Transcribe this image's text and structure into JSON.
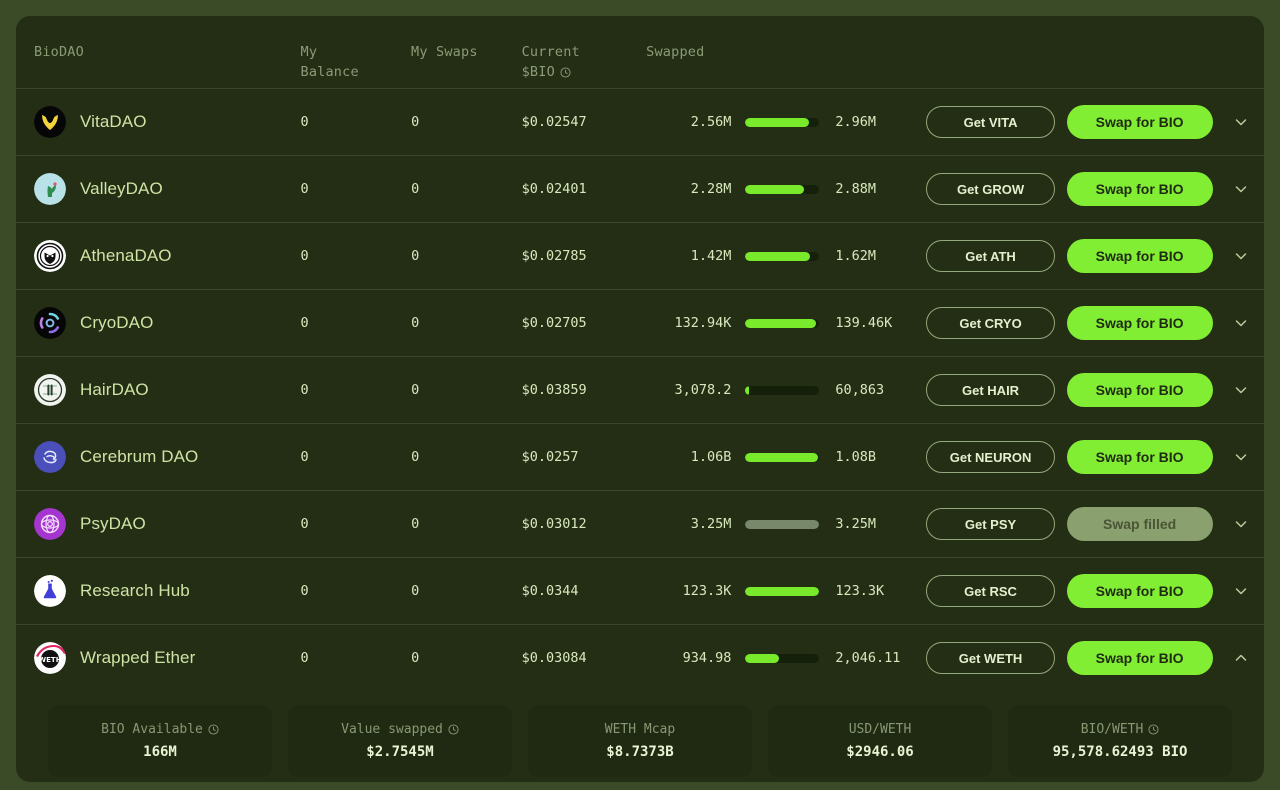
{
  "theme": {
    "page_bg": "#3b4a27",
    "card_bg": "#242e15",
    "accent_green": "#82ee33",
    "bar_fill": "#79e92c",
    "bar_track": "#14200a",
    "muted_fill": "#78886a",
    "text": "#d8e8bd",
    "muted_text": "#8b9b76"
  },
  "table": {
    "columns": [
      {
        "key": "biodao",
        "label": "BioDAO"
      },
      {
        "key": "balance",
        "label": "My\nBalance"
      },
      {
        "key": "swaps",
        "label": "My Swaps"
      },
      {
        "key": "price",
        "label": "Current\n$BIO",
        "info_icon": "clock-info-icon"
      },
      {
        "key": "swapped",
        "label": "Swapped"
      }
    ],
    "header": {
      "biodao": "BioDAO",
      "balance_line1": "My",
      "balance_line2": "Balance",
      "swaps": "My Swaps",
      "price_line1": "Current",
      "price_line2": "$BIO",
      "swapped": "Swapped"
    },
    "rows": [
      {
        "name": "VitaDAO",
        "icon": "vitadao-logo",
        "balance": "0",
        "swaps": "0",
        "price": "$0.02547",
        "swapped_current": "2.56M",
        "swapped_target": "2.96M",
        "progress_pct": 86,
        "get_label": "Get VITA",
        "swap_label": "Swap for BIO",
        "swap_disabled": false,
        "chevron": "chevron-down-icon"
      },
      {
        "name": "ValleyDAO",
        "icon": "valleydao-logo",
        "balance": "0",
        "swaps": "0",
        "price": "$0.02401",
        "swapped_current": "2.28M",
        "swapped_target": "2.88M",
        "progress_pct": 79,
        "get_label": "Get GROW",
        "swap_label": "Swap for BIO",
        "swap_disabled": false,
        "chevron": "chevron-down-icon"
      },
      {
        "name": "AthenaDAO",
        "icon": "athenadao-logo",
        "balance": "0",
        "swaps": "0",
        "price": "$0.02785",
        "swapped_current": "1.42M",
        "swapped_target": "1.62M",
        "progress_pct": 88,
        "get_label": "Get ATH",
        "swap_label": "Swap for BIO",
        "swap_disabled": false,
        "chevron": "chevron-down-icon"
      },
      {
        "name": "CryoDAO",
        "icon": "cryodao-logo",
        "balance": "0",
        "swaps": "0",
        "price": "$0.02705",
        "swapped_current": "132.94K",
        "swapped_target": "139.46K",
        "progress_pct": 95,
        "get_label": "Get CRYO",
        "swap_label": "Swap for BIO",
        "swap_disabled": false,
        "chevron": "chevron-down-icon"
      },
      {
        "name": "HairDAO",
        "icon": "hairdao-logo",
        "balance": "0",
        "swaps": "0",
        "price": "$0.03859",
        "swapped_current": "3,078.2",
        "swapped_target": "60,863",
        "progress_pct": 5,
        "get_label": "Get HAIR",
        "swap_label": "Swap for BIO",
        "swap_disabled": false,
        "chevron": "chevron-down-icon"
      },
      {
        "name": "Cerebrum DAO",
        "icon": "cerebrumdao-logo",
        "balance": "0",
        "swaps": "0",
        "price": "$0.0257",
        "swapped_current": "1.06B",
        "swapped_target": "1.08B",
        "progress_pct": 98,
        "get_label": "Get NEURON",
        "swap_label": "Swap for BIO",
        "swap_disabled": false,
        "chevron": "chevron-down-icon"
      },
      {
        "name": "PsyDAO",
        "icon": "psydao-logo",
        "balance": "0",
        "swaps": "0",
        "price": "$0.03012",
        "swapped_current": "3.25M",
        "swapped_target": "3.25M",
        "progress_pct": 100,
        "get_label": "Get PSY",
        "swap_label": "Swap filled",
        "swap_disabled": true,
        "chevron": "chevron-down-icon"
      },
      {
        "name": "Research Hub",
        "icon": "researchhub-logo",
        "balance": "0",
        "swaps": "0",
        "price": "$0.0344",
        "swapped_current": "123.3K",
        "swapped_target": "123.3K",
        "progress_pct": 100,
        "get_label": "Get RSC",
        "swap_label": "Swap for BIO",
        "swap_disabled": false,
        "chevron": "chevron-down-icon"
      },
      {
        "name": "Wrapped Ether",
        "icon": "weth-logo",
        "balance": "0",
        "swaps": "0",
        "price": "$0.03084",
        "swapped_current": "934.98",
        "swapped_target": "2,046.11",
        "progress_pct": 46,
        "get_label": "Get WETH",
        "swap_label": "Swap for BIO",
        "swap_disabled": false,
        "chevron": "chevron-up-icon"
      }
    ]
  },
  "stats": [
    {
      "label": "BIO Available",
      "value": "166M",
      "info_icon": "clock-info-icon"
    },
    {
      "label": "Value swapped",
      "value": "$2.7545M",
      "info_icon": "clock-info-icon"
    },
    {
      "label": "WETH Mcap",
      "value": "$8.7373B",
      "info_icon": null
    },
    {
      "label": "USD/WETH",
      "value": "$2946.06",
      "info_icon": null
    },
    {
      "label": "BIO/WETH",
      "value": "95,578.62493 BIO",
      "info_icon": "clock-info-icon"
    }
  ]
}
